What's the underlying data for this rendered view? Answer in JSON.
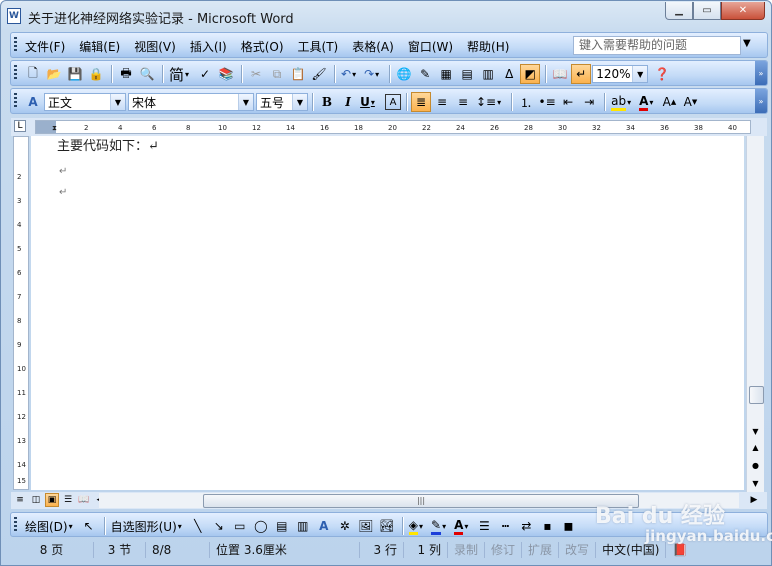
{
  "window": {
    "title": "关于进化神经网络实验记录 - Microsoft Word",
    "app_icon": "W"
  },
  "menubar": {
    "items": [
      "文件(F)",
      "编辑(E)",
      "视图(V)",
      "插入(I)",
      "格式(O)",
      "工具(T)",
      "表格(A)",
      "窗口(W)",
      "帮助(H)"
    ],
    "help_placeholder": "键入需要帮助的问题"
  },
  "toolbar": {
    "chinese_conv": "简",
    "zoom": "120%"
  },
  "format": {
    "style": "正文",
    "font": "宋体",
    "size": "五号"
  },
  "document": {
    "first_line": "主要代码如下：↵",
    "paragraph_marks": [
      "↵",
      "↵"
    ]
  },
  "ruler": {
    "h_ticks": [
      "2",
      "4",
      "6",
      "8",
      "10",
      "12",
      "14",
      "16",
      "18",
      "20",
      "22",
      "24",
      "26",
      "28",
      "30",
      "32",
      "34",
      "36",
      "38",
      "40"
    ],
    "v_ticks": [
      "2",
      "3",
      "4",
      "5",
      "6",
      "7",
      "8",
      "9",
      "10",
      "11",
      "12",
      "13",
      "14",
      "15"
    ]
  },
  "drawing": {
    "draw_label": "绘图(D)",
    "autoshapes_label": "自选图形(U)"
  },
  "status": {
    "page": "8 页",
    "section": "3 节",
    "page_of": "8/8",
    "position": "位置 3.6厘米",
    "line": "3 行",
    "col": "1 列",
    "rec": "录制",
    "trk": "修订",
    "ext": "扩展",
    "ovr": "改写",
    "lang": "中文(中国)"
  },
  "watermark": {
    "text": "Bai du 经验",
    "sub": "jingyan.baidu.com"
  }
}
